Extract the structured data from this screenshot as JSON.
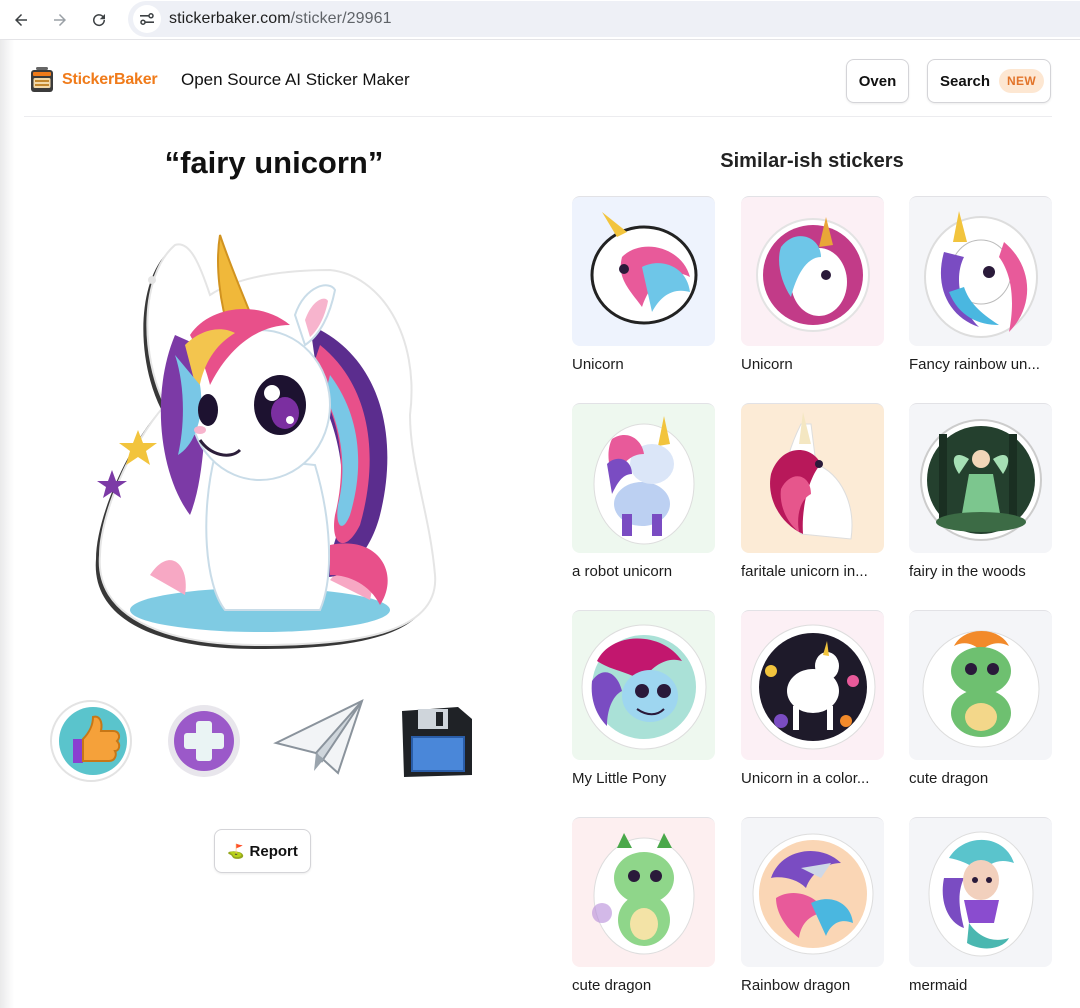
{
  "browser": {
    "url_host": "stickerbaker.com",
    "url_path": "/sticker/29961"
  },
  "header": {
    "logo_text": "StickerBaker",
    "tagline": "Open Source AI Sticker Maker",
    "oven_label": "Oven",
    "search_label": "Search",
    "search_badge": "NEW"
  },
  "sticker": {
    "title": "“fairy unicorn”",
    "report_label": "Report",
    "report_icon": "⛳"
  },
  "similar": {
    "title": "Similar-ish stickers",
    "items": [
      {
        "caption": "Unicorn",
        "bg": "#eef3fd"
      },
      {
        "caption": "Unicorn",
        "bg": "#fcf0f5"
      },
      {
        "caption": "Fancy rainbow un...",
        "bg": "#f4f5f8"
      },
      {
        "caption": "a robot unicorn",
        "bg": "#eef8ef"
      },
      {
        "caption": "faritale unicorn in...",
        "bg": "#fcebd6"
      },
      {
        "caption": "fairy in the woods",
        "bg": "#f4f5f8"
      },
      {
        "caption": "My Little Pony",
        "bg": "#eef8ef"
      },
      {
        "caption": "Unicorn in a color...",
        "bg": "#fcf0f5"
      },
      {
        "caption": "cute dragon",
        "bg": "#f4f5f8"
      },
      {
        "caption": "cute dragon",
        "bg": "#fdeff0"
      },
      {
        "caption": "Rainbow dragon",
        "bg": "#f4f5f8"
      },
      {
        "caption": "mermaid",
        "bg": "#f4f5f8"
      }
    ]
  },
  "colors": {
    "brand_orange": "#f07b1a",
    "badge_bg": "#fde7d2"
  }
}
